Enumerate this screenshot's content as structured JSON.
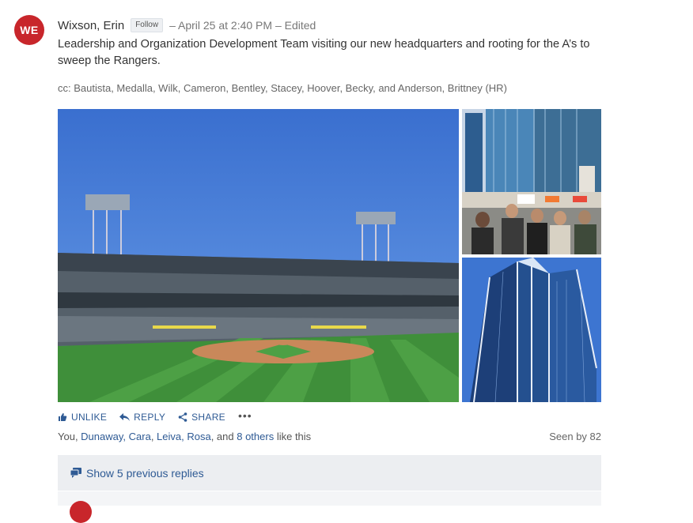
{
  "post": {
    "avatar_initials": "WE",
    "author": "Wixson, Erin",
    "follow_label": "Follow",
    "meta": "– April 25 at 2:40 PM – Edited",
    "message": "Leadership and Organization Development Team visiting our new headquarters and rooting for the A’s to sweep the Rangers.",
    "cc": "cc: Bautista, Medalla, Wilk, Cameron, Bentley, Stacey, Hoover, Becky, and Anderson, Brittney (HR)"
  },
  "actions": {
    "unlike": "UNLIKE",
    "reply": "REPLY",
    "share": "SHARE",
    "more": "•••"
  },
  "likes": {
    "you": "You, ",
    "person1": "Dunaway, Cara",
    "sep1": ", ",
    "person2": "Leiva, Rosa",
    "sep2": ", and ",
    "others": "8 others",
    "suffix": " like this"
  },
  "seen": "Seen by 82",
  "replies": {
    "show_previous": "Show 5 previous replies"
  },
  "colors": {
    "brand_red": "#c8262b",
    "link_blue": "#2e5a94",
    "muted_bg": "#eceef1"
  }
}
